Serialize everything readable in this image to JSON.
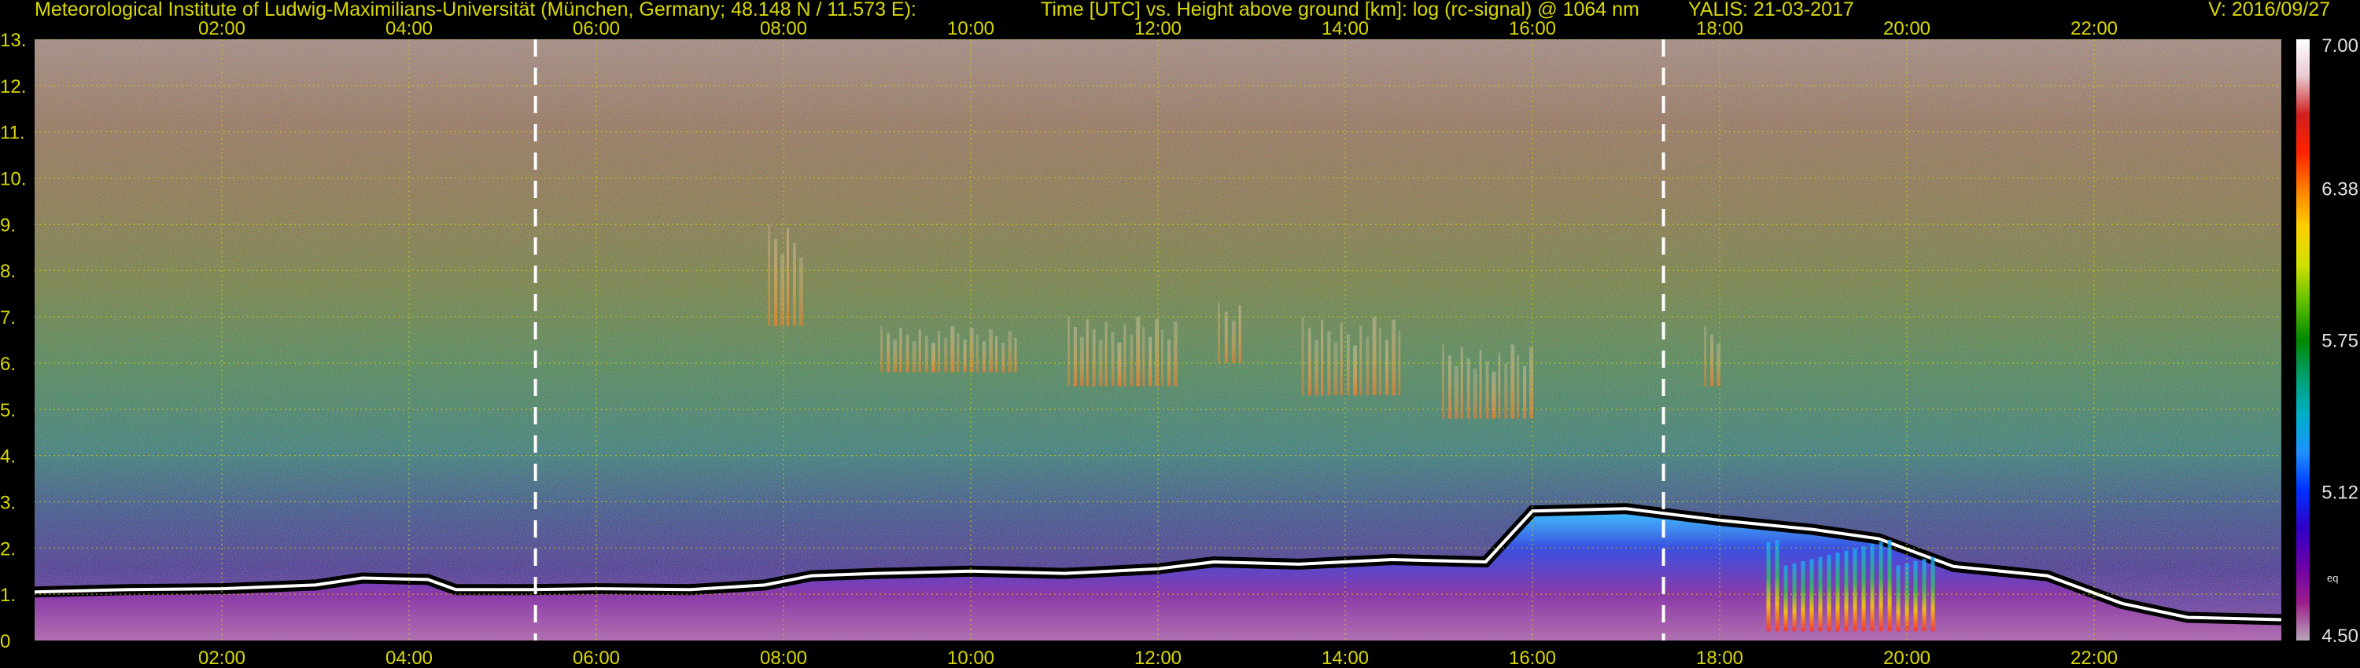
{
  "header": {
    "institute": "Meteorological Institute of Ludwig-Maximilians-Universität (München, Germany; 48.148 N / 11.573 E):",
    "plot_desc": "Time [UTC] vs. Height above ground [km]: log (rc-signal) @ 1064 nm",
    "instrument": "YALIS: 21-03-2017",
    "version": "V: 2016/09/27"
  },
  "chart_data": {
    "type": "heatmap",
    "title": "Time [UTC] vs. Height above ground [km]: log (rc-signal) @ 1064 nm",
    "xlabel": "",
    "ylabel": "",
    "x_ticks": [
      "02:00",
      "04:00",
      "06:00",
      "08:00",
      "10:00",
      "12:00",
      "14:00",
      "16:00",
      "18:00",
      "20:00",
      "22:00"
    ],
    "x_tick_hours": [
      2,
      4,
      6,
      8,
      10,
      12,
      14,
      16,
      18,
      20,
      22
    ],
    "xlim_hours": [
      0.0,
      24.0
    ],
    "y_ticks": [
      "0",
      "1.",
      "2.",
      "3.",
      "4.",
      "5.",
      "6.",
      "7.",
      "8.",
      "9.",
      "10.",
      "11.",
      "12.",
      "13."
    ],
    "y_tick_values": [
      0,
      1,
      2,
      3,
      4,
      5,
      6,
      7,
      8,
      9,
      10,
      11,
      12,
      13
    ],
    "ylim": [
      0,
      13
    ],
    "grid": true,
    "marker_lines_hours": [
      5.35,
      17.4
    ],
    "colorbar": {
      "ticks": [
        "7.00",
        "6.38",
        "5.75",
        "5.12",
        "4.50"
      ],
      "tick_values": [
        7.0,
        6.38,
        5.75,
        5.12,
        4.5
      ],
      "range": [
        4.5,
        7.0
      ],
      "unit_label": "eq",
      "colors": [
        "#b8a6b8",
        "#9c1e8c",
        "#6a00a8",
        "#2f00c8",
        "#0030ff",
        "#1e90ff",
        "#00b0c8",
        "#00a070",
        "#008800",
        "#60c000",
        "#d0e000",
        "#ffd000",
        "#ff8000",
        "#ff2000",
        "#d02020",
        "#e8c8d0",
        "#ffffff"
      ]
    },
    "boundary_layer_top_km": [
      {
        "t": 0.0,
        "h": 1.05
      },
      {
        "t": 1.0,
        "h": 1.1
      },
      {
        "t": 2.0,
        "h": 1.12
      },
      {
        "t": 3.0,
        "h": 1.2
      },
      {
        "t": 3.5,
        "h": 1.35
      },
      {
        "t": 4.2,
        "h": 1.32
      },
      {
        "t": 4.5,
        "h": 1.1
      },
      {
        "t": 5.3,
        "h": 1.1
      },
      {
        "t": 6.0,
        "h": 1.12
      },
      {
        "t": 7.0,
        "h": 1.1
      },
      {
        "t": 7.8,
        "h": 1.2
      },
      {
        "t": 8.3,
        "h": 1.4
      },
      {
        "t": 9.0,
        "h": 1.45
      },
      {
        "t": 10.0,
        "h": 1.5
      },
      {
        "t": 11.0,
        "h": 1.45
      },
      {
        "t": 12.0,
        "h": 1.55
      },
      {
        "t": 12.6,
        "h": 1.7
      },
      {
        "t": 13.5,
        "h": 1.65
      },
      {
        "t": 14.5,
        "h": 1.75
      },
      {
        "t": 15.5,
        "h": 1.7
      },
      {
        "t": 16.0,
        "h": 2.8
      },
      {
        "t": 17.0,
        "h": 2.85
      },
      {
        "t": 17.4,
        "h": 2.75
      },
      {
        "t": 18.0,
        "h": 2.6
      },
      {
        "t": 19.0,
        "h": 2.4
      },
      {
        "t": 19.7,
        "h": 2.2
      },
      {
        "t": 20.5,
        "h": 1.6
      },
      {
        "t": 21.5,
        "h": 1.4
      },
      {
        "t": 22.3,
        "h": 0.8
      },
      {
        "t": 23.0,
        "h": 0.5
      },
      {
        "t": 24.0,
        "h": 0.45
      }
    ],
    "cirrus_patches": [
      {
        "t0": 7.8,
        "t1": 8.2,
        "h0": 6.8,
        "h1": 9.0
      },
      {
        "t0": 9.0,
        "t1": 10.5,
        "h0": 5.8,
        "h1": 6.8
      },
      {
        "t0": 11.0,
        "t1": 12.2,
        "h0": 5.5,
        "h1": 7.0
      },
      {
        "t0": 12.6,
        "t1": 12.9,
        "h0": 6.0,
        "h1": 7.3
      },
      {
        "t0": 13.5,
        "t1": 14.6,
        "h0": 5.3,
        "h1": 7.0
      },
      {
        "t0": 15.0,
        "t1": 16.0,
        "h0": 4.8,
        "h1": 6.4
      },
      {
        "t0": 17.8,
        "t1": 18.0,
        "h0": 5.5,
        "h1": 6.8
      }
    ],
    "precip_streaks": [
      {
        "t0": 18.5,
        "t1": 20.3,
        "h0": 0.2,
        "h1": 2.2
      }
    ]
  }
}
